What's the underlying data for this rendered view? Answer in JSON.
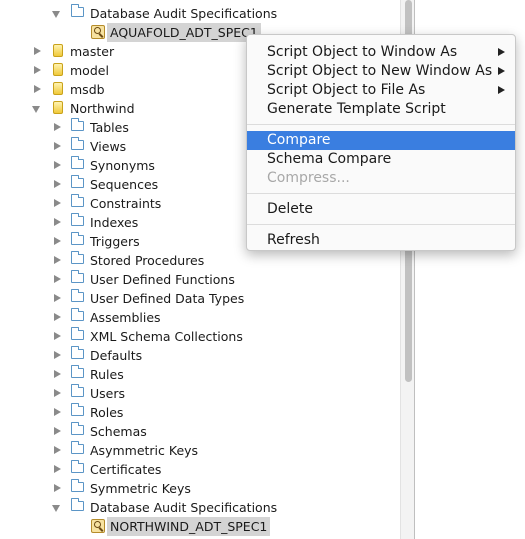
{
  "tree": {
    "audit_spec_top": "Database Audit Specifications",
    "aquafold_spec": "AQUAFOLD_ADT_SPEC1",
    "databases": {
      "master": "master",
      "model": "model",
      "msdb": "msdb",
      "northwind": "Northwind"
    },
    "northwind_children": [
      "Tables",
      "Views",
      "Synonyms",
      "Sequences",
      "Constraints",
      "Indexes",
      "Triggers",
      "Stored Procedures",
      "User Defined Functions",
      "User Defined Data Types",
      "Assemblies",
      "XML Schema Collections",
      "Defaults",
      "Rules",
      "Users",
      "Roles",
      "Schemas",
      "Asymmetric Keys",
      "Certificates",
      "Symmetric Keys",
      "Database Audit Specifications"
    ],
    "northwind_spec": "NORTHWIND_ADT_SPEC1"
  },
  "context_menu": {
    "script_window": "Script Object to Window As",
    "script_new_window": "Script Object to New Window As",
    "script_file": "Script Object to File As",
    "generate_template": "Generate Template Script",
    "compare": "Compare",
    "schema_compare": "Schema Compare",
    "compress": "Compress...",
    "delete": "Delete",
    "refresh": "Refresh"
  },
  "colors": {
    "highlight": "#3a7ee0",
    "selection": "#d4d4d4",
    "folder": "#5b95c6"
  }
}
